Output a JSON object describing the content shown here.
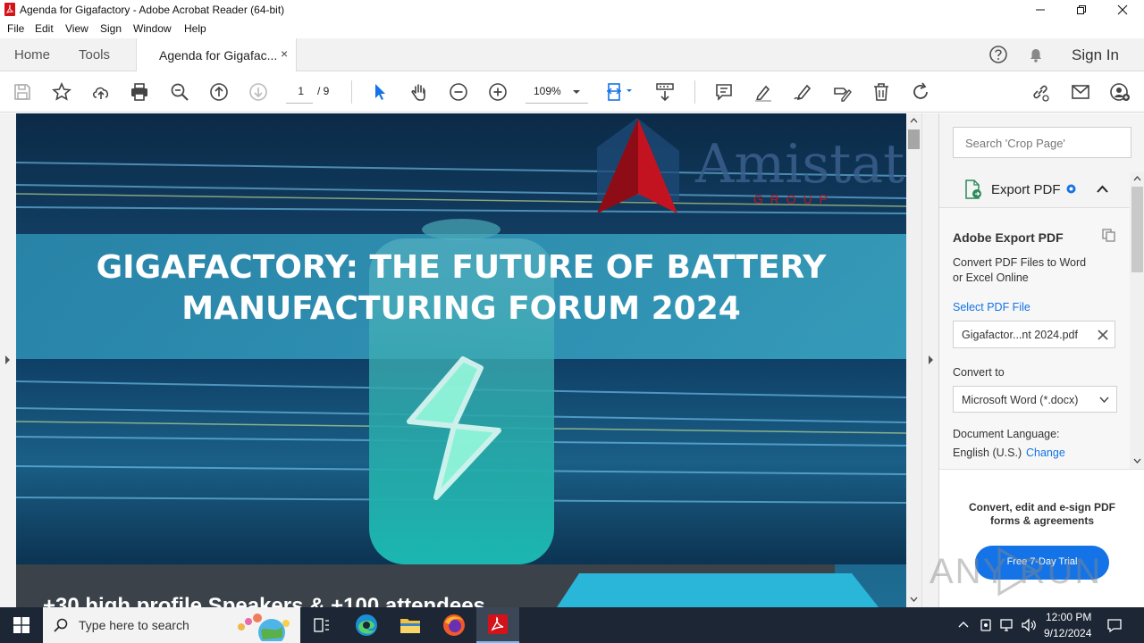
{
  "window": {
    "title": "Agenda for Gigafactory - Adobe Acrobat Reader (64-bit)",
    "minimize_icon": "minimize-icon",
    "maximize_icon": "restore-icon",
    "close_icon": "close-icon"
  },
  "menu": [
    "File",
    "Edit",
    "View",
    "Sign",
    "Window",
    "Help"
  ],
  "tabs": {
    "home": "Home",
    "tools": "Tools",
    "document": "Agenda for Gigafac...",
    "close": "×",
    "sign_in": "Sign In"
  },
  "toolbar": {
    "page_current": "1",
    "page_total": "/ 9",
    "zoom": "109%"
  },
  "document": {
    "logo_name": "Amistat",
    "logo_sub": "G R O U P",
    "headline_line1": "GIGAFACTORY: THE FUTURE OF BATTERY",
    "headline_line2": "MANUFACTURING FORUM 2024",
    "bottom_text": "+30 high profile Speakers & +100 attendees"
  },
  "panel": {
    "search_placeholder": "Search 'Crop Page'",
    "export_title": "Export PDF",
    "adobe_export_title": "Adobe Export PDF",
    "convert_desc_1": "Convert PDF Files to Word",
    "convert_desc_2": "or Excel Online",
    "select_file_label": "Select PDF File",
    "selected_file": "Gigafactor...nt 2024.pdf",
    "convert_to_label": "Convert to",
    "convert_to_value": "Microsoft Word (*.docx)",
    "doc_lang_label": "Document Language:",
    "doc_lang_value": "English (U.S.)",
    "change_link": "Change",
    "promo_line1": "Convert, edit and e-sign PDF",
    "promo_line2": "forms & agreements",
    "trial_button": "Free 7-Day Trial"
  },
  "taskbar": {
    "search_placeholder": "Type here to search",
    "time": "12:00 PM",
    "date": "9/12/2024"
  },
  "watermark": "ANY RUN",
  "colors": {
    "accent_blue": "#1473e6",
    "acrobat_red": "#d4121a",
    "taskbar": "#1c2634",
    "headline": "#ffffff"
  }
}
